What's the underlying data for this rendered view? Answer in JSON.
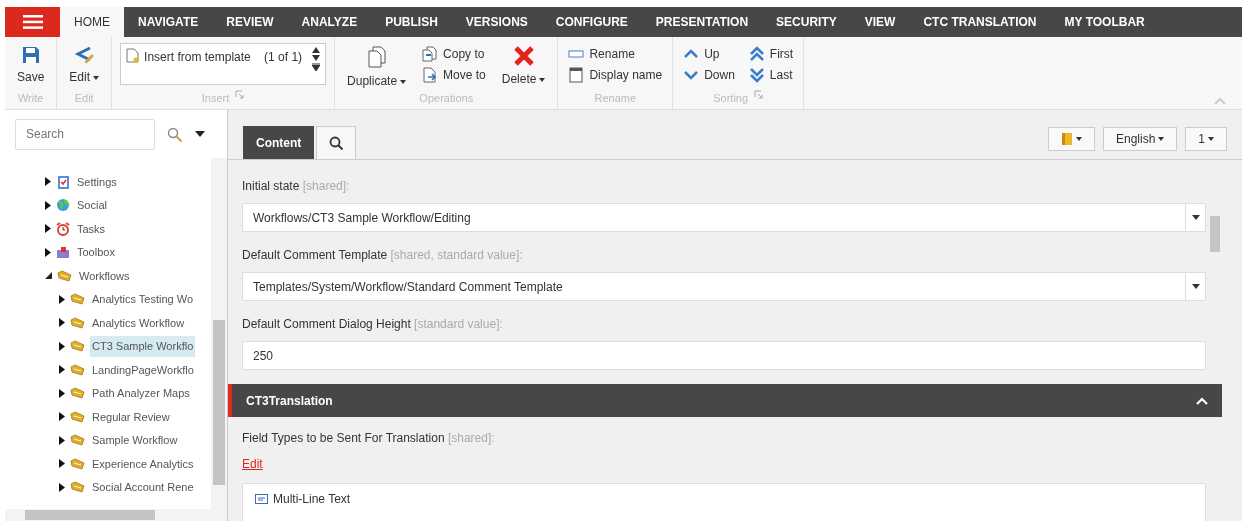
{
  "menu_tabs": [
    {
      "label": "HOME",
      "selected": true
    },
    {
      "label": "NAVIGATE",
      "selected": false
    },
    {
      "label": "REVIEW",
      "selected": false
    },
    {
      "label": "ANALYZE",
      "selected": false
    },
    {
      "label": "PUBLISH",
      "selected": false
    },
    {
      "label": "VERSIONS",
      "selected": false
    },
    {
      "label": "CONFIGURE",
      "selected": false
    },
    {
      "label": "PRESENTATION",
      "selected": false
    },
    {
      "label": "SECURITY",
      "selected": false
    },
    {
      "label": "VIEW",
      "selected": false
    },
    {
      "label": "CTC TRANSLATION",
      "selected": false
    },
    {
      "label": "MY TOOLBAR",
      "selected": false
    }
  ],
  "ribbon": {
    "groups": [
      {
        "label": "Write",
        "launcher": false,
        "items": [
          {
            "kind": "large",
            "label": "Save",
            "dropdown": false
          }
        ]
      },
      {
        "label": "Edit",
        "launcher": false,
        "items": [
          {
            "kind": "large",
            "label": "Edit",
            "dropdown": true
          }
        ]
      },
      {
        "label": "Insert",
        "launcher": true,
        "items": [
          {
            "kind": "gallery",
            "label": "Insert from template",
            "count": "(1 of 1)"
          }
        ]
      },
      {
        "label": "Operations",
        "launcher": false,
        "items": [
          {
            "kind": "large",
            "label": "Duplicate",
            "dropdown": true
          },
          {
            "kind": "stack",
            "buttons": [
              "Copy to",
              "Move to"
            ]
          },
          {
            "kind": "large",
            "label": "Delete",
            "dropdown": true
          }
        ]
      },
      {
        "label": "Rename",
        "launcher": false,
        "items": [
          {
            "kind": "stack",
            "buttons": [
              "Rename",
              "Display name"
            ]
          }
        ]
      },
      {
        "label": "Sorting",
        "launcher": true,
        "items": [
          {
            "kind": "stack",
            "buttons": [
              "Up",
              "Down"
            ]
          },
          {
            "kind": "stack",
            "buttons": [
              "First",
              "Last"
            ]
          }
        ]
      }
    ]
  },
  "search": {
    "placeholder": "Search"
  },
  "tree": [
    {
      "label": "Settings",
      "expanded": false,
      "selected": false
    },
    {
      "label": "Social",
      "expanded": false,
      "selected": false
    },
    {
      "label": "Tasks",
      "expanded": false,
      "selected": false
    },
    {
      "label": "Toolbox",
      "expanded": false,
      "selected": false
    },
    {
      "label": "Workflows",
      "expanded": true,
      "selected": false,
      "children": [
        {
          "label": "Analytics Testing Wo",
          "expanded": false,
          "selected": false
        },
        {
          "label": "Analytics Workflow",
          "expanded": false,
          "selected": false
        },
        {
          "label": "CT3 Sample Workflo",
          "expanded": false,
          "selected": true
        },
        {
          "label": "LandingPageWorkflo",
          "expanded": false,
          "selected": false
        },
        {
          "label": "Path Analyzer Maps",
          "expanded": false,
          "selected": false
        },
        {
          "label": "Regular Review",
          "expanded": false,
          "selected": false
        },
        {
          "label": "Sample Workflow",
          "expanded": false,
          "selected": false
        },
        {
          "label": "Experience Analytics",
          "expanded": false,
          "selected": false
        },
        {
          "label": "Social Account Rene",
          "expanded": false,
          "selected": false
        }
      ]
    }
  ],
  "editor_tabs": [
    {
      "kind": "text",
      "label": "Content",
      "selected": true
    },
    {
      "kind": "search",
      "selected": false
    }
  ],
  "editor_buttons": [
    {
      "kind": "icon"
    },
    {
      "kind": "text",
      "label": "English"
    },
    {
      "kind": "text",
      "label": "1"
    }
  ],
  "fields": [
    {
      "kind": "dropdown",
      "label": "Initial state",
      "hint": "[shared]:",
      "value": "Workflows/CT3 Sample Workflow/Editing"
    },
    {
      "kind": "dropdown",
      "label": "Default Comment Template",
      "hint": "[shared, standard value]:",
      "value": "Templates/System/Workflow/Standard Comment Template"
    },
    {
      "kind": "text",
      "label": "Default Comment Dialog Height",
      "hint": "[standard value]:",
      "value": "250"
    },
    {
      "kind": "section",
      "title": "CT3Translation",
      "expanded": true
    },
    {
      "kind": "multilist",
      "label": "Field Types to be Sent For Translation",
      "hint": "[shared]:",
      "link": "Edit",
      "items": [
        "Multi-Line Text"
      ]
    }
  ]
}
